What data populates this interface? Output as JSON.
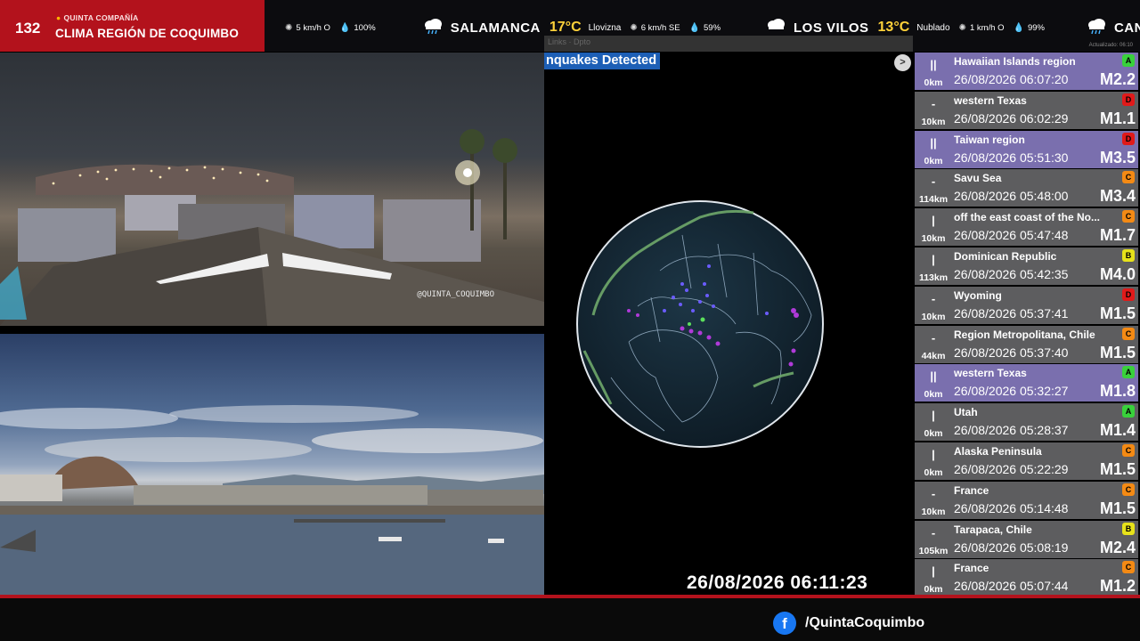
{
  "brand": {
    "number": "132",
    "org": "QUINTA COMPAÑÍA",
    "title": "CLIMA REGIÓN DE COQUIMBO"
  },
  "ticker": [
    {
      "city": "",
      "temp": "",
      "condition": "",
      "wind": "5 km/h O",
      "humidity": "100%",
      "icon": "none"
    },
    {
      "city": "SALAMANCA",
      "temp": "17°C",
      "condition": "Llovizna",
      "wind": "6 km/h SE",
      "humidity": "59%",
      "icon": "rain-cloud-icon"
    },
    {
      "city": "LOS VILOS",
      "temp": "13°C",
      "condition": "Nublado",
      "wind": "1 km/h O",
      "humidity": "99%",
      "icon": "cloud-icon"
    },
    {
      "city": "CAN",
      "temp": "",
      "condition": "",
      "wind": "",
      "humidity": "",
      "icon": "rain-cloud-icon"
    }
  ],
  "updated_label": "Actualizado: 06:10",
  "map_links": "Links · Dpto",
  "camera": {
    "watermark": "@QUINTA_COQUIMBO"
  },
  "map": {
    "banner": "nquakes Detected",
    "next": ">",
    "clock": "26/08/2026 06:11:23"
  },
  "quakes": [
    {
      "location": "Hawaiian Islands region",
      "time": "26/08/2026 06:07:20",
      "mag": "M2.2",
      "depth": "0km",
      "badge": "A",
      "badge_color": "#39d13b",
      "marker": "||",
      "live": true
    },
    {
      "location": "western Texas",
      "time": "26/08/2026 06:02:29",
      "mag": "M1.1",
      "depth": "10km",
      "badge": "D",
      "badge_color": "#e01a1a",
      "marker": "-",
      "live": false
    },
    {
      "location": "Taiwan region",
      "time": "26/08/2026 05:51:30",
      "mag": "M3.5",
      "depth": "0km",
      "badge": "D",
      "badge_color": "#e01a1a",
      "marker": "||",
      "live": true
    },
    {
      "location": "Savu Sea",
      "time": "26/08/2026 05:48:00",
      "mag": "M3.4",
      "depth": "114km",
      "badge": "C",
      "badge_color": "#f48a14",
      "marker": "-",
      "live": false
    },
    {
      "location": "off the east coast of the No...",
      "time": "26/08/2026 05:47:48",
      "mag": "M1.7",
      "depth": "10km",
      "badge": "C",
      "badge_color": "#f48a14",
      "marker": "|",
      "live": false
    },
    {
      "location": "Dominican Republic",
      "time": "26/08/2026 05:42:35",
      "mag": "M4.0",
      "depth": "113km",
      "badge": "B",
      "badge_color": "#e7e21a",
      "marker": "|",
      "live": false
    },
    {
      "location": "Wyoming",
      "time": "26/08/2026 05:37:41",
      "mag": "M1.5",
      "depth": "10km",
      "badge": "D",
      "badge_color": "#e01a1a",
      "marker": "-",
      "live": false
    },
    {
      "location": "Region Metropolitana, Chile",
      "time": "26/08/2026 05:37:40",
      "mag": "M1.5",
      "depth": "44km",
      "badge": "C",
      "badge_color": "#f48a14",
      "marker": "-",
      "live": false
    },
    {
      "location": "western Texas",
      "time": "26/08/2026 05:32:27",
      "mag": "M1.8",
      "depth": "0km",
      "badge": "A",
      "badge_color": "#39d13b",
      "marker": "||",
      "live": true
    },
    {
      "location": "Utah",
      "time": "26/08/2026 05:28:37",
      "mag": "M1.4",
      "depth": "0km",
      "badge": "A",
      "badge_color": "#39d13b",
      "marker": "|",
      "live": false
    },
    {
      "location": "Alaska Peninsula",
      "time": "26/08/2026 05:22:29",
      "mag": "M1.5",
      "depth": "0km",
      "badge": "C",
      "badge_color": "#f48a14",
      "marker": "|",
      "live": false
    },
    {
      "location": "France",
      "time": "26/08/2026 05:14:48",
      "mag": "M1.5",
      "depth": "10km",
      "badge": "C",
      "badge_color": "#f48a14",
      "marker": "-",
      "live": false
    },
    {
      "location": "Tarapaca, Chile",
      "time": "26/08/2026 05:08:19",
      "mag": "M2.4",
      "depth": "105km",
      "badge": "B",
      "badge_color": "#e7e21a",
      "marker": "-",
      "live": false
    },
    {
      "location": "France",
      "time": "26/08/2026 05:07:44",
      "mag": "M1.2",
      "depth": "0km",
      "badge": "C",
      "badge_color": "#f48a14",
      "marker": "|",
      "live": false
    }
  ],
  "footer": {
    "fb_icon": "f",
    "handle": "/QuintaCoquimbo"
  },
  "colors": {
    "brand_red": "#b3121c",
    "temp_yellow": "#ffd23a",
    "live_row": "#7a6fae",
    "row": "#5d5d5f"
  }
}
